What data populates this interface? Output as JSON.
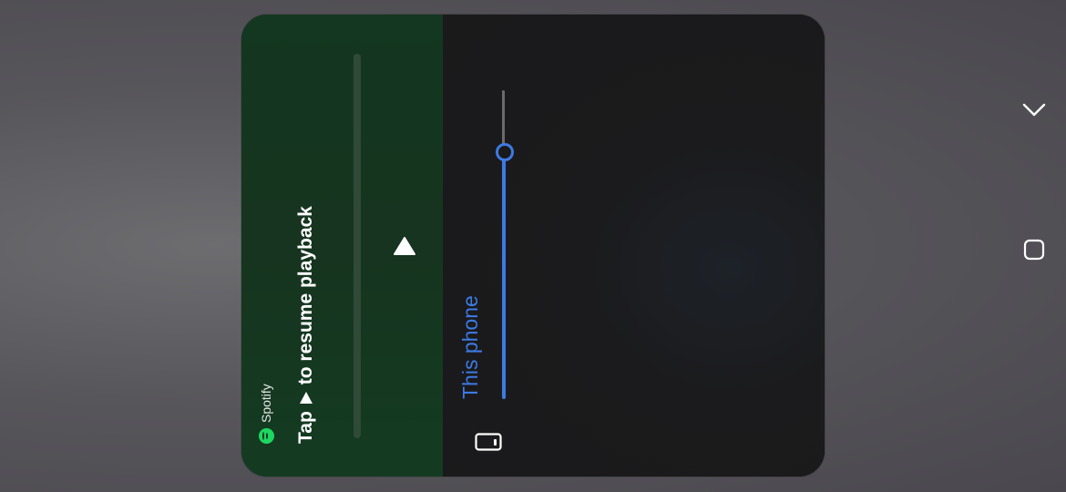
{
  "media": {
    "app_name": "Spotify",
    "resume_prefix": "Tap",
    "resume_suffix": "to resume playback",
    "play_icon": "play-icon"
  },
  "volume": {
    "device_label": "This phone",
    "level_percent": 80,
    "device_icon": "phone-landscape-icon"
  },
  "navigation": {
    "collapse_icon": "chevron-down-icon",
    "settings_icon": "rounded-square-icon"
  },
  "colors": {
    "accent": "#3d7ae4",
    "spotify_green": "#1ed760",
    "media_background": "#133720",
    "panel_background": "#1a1a1b"
  }
}
